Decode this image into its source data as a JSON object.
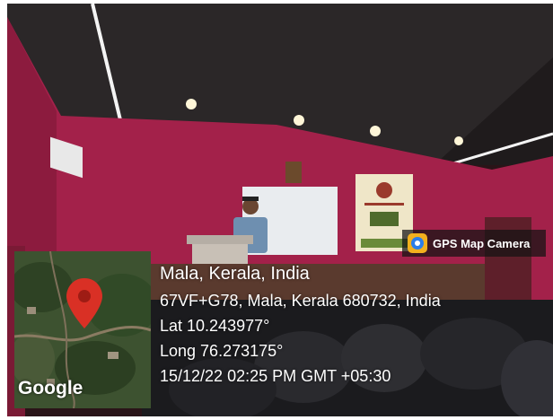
{
  "badge": {
    "label": "GPS Map Camera",
    "icon": "gps-map-camera-icon"
  },
  "map": {
    "logo": "Google",
    "pin_color": "#d93025"
  },
  "location": {
    "place": "Mala, Kerala, India",
    "address": "67VF+G78, Mala, Kerala 680732, India",
    "latitude": "Lat 10.243977°",
    "longitude": "Long 76.273175°",
    "timestamp": "15/12/22 02:25 PM GMT +05:30"
  }
}
